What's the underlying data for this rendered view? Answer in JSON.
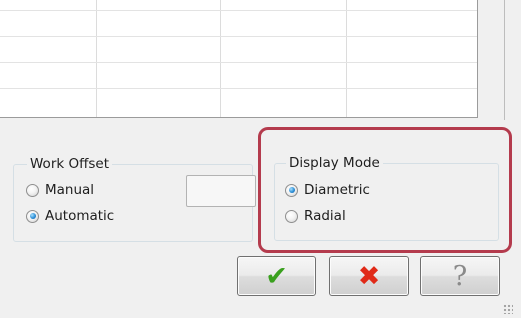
{
  "work_offset": {
    "title": "Work Offset",
    "options": [
      {
        "label": "Manual",
        "checked": false
      },
      {
        "label": "Automatic",
        "checked": true
      }
    ]
  },
  "display_mode": {
    "title": "Display Mode",
    "options": [
      {
        "label": "Diametric",
        "checked": true
      },
      {
        "label": "Radial",
        "checked": false
      }
    ]
  },
  "buttons": {
    "ok_icon": "checkmark-icon",
    "cancel_icon": "x-icon",
    "help_icon": "question-icon"
  },
  "colors": {
    "highlight": "#b43b4d",
    "ok": "#3aa01e",
    "cancel": "#e02a18"
  }
}
